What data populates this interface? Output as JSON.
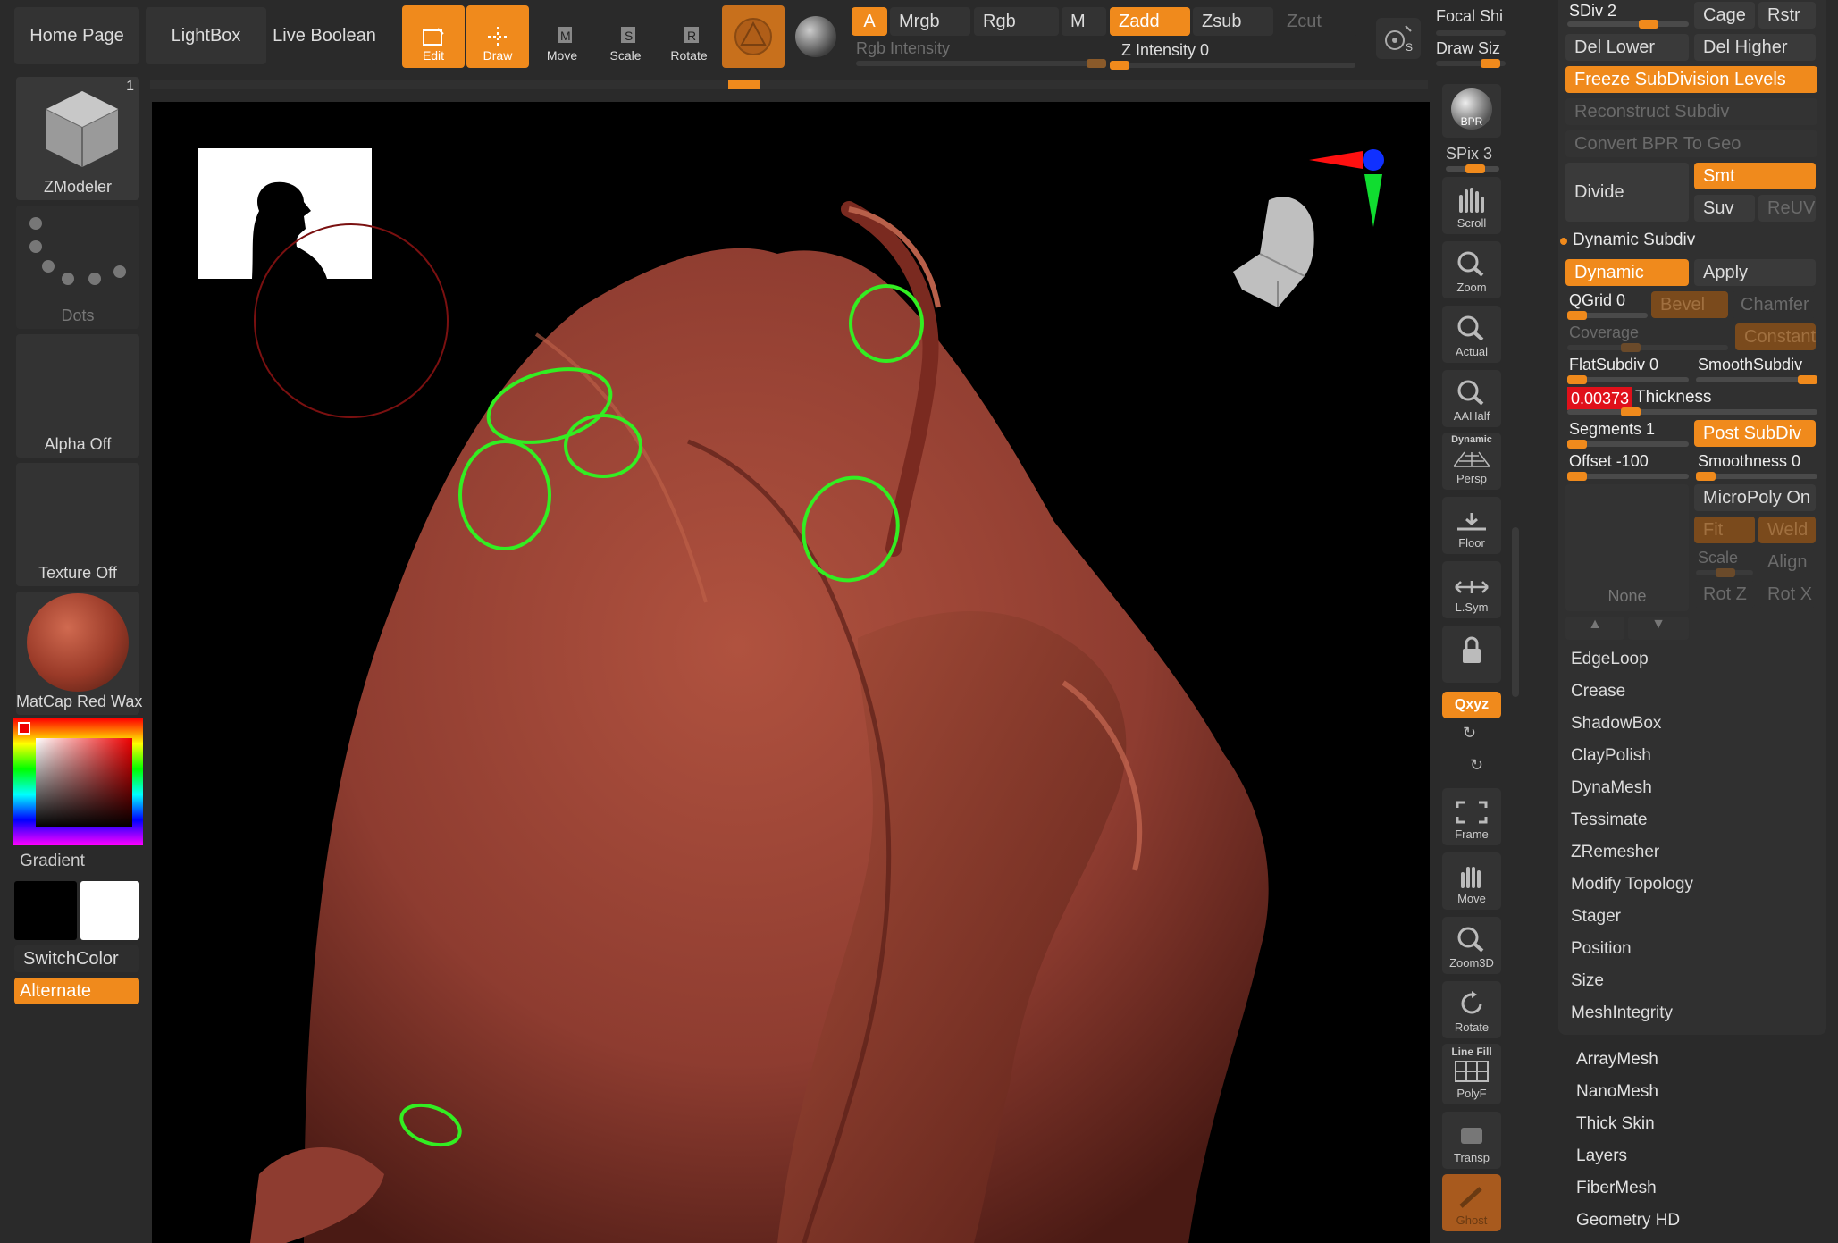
{
  "top_nav": {
    "home": "Home Page",
    "lightbox": "LightBox",
    "live_boolean": "Live Boolean"
  },
  "tools": {
    "edit": "Edit",
    "draw": "Draw",
    "move": "Move",
    "scale": "Scale",
    "rotate": "Rotate"
  },
  "color_modes": {
    "a": "A",
    "mrgb": "Mrgb",
    "rgb": "Rgb",
    "m": "M",
    "zadd": "Zadd",
    "zsub": "Zsub",
    "zcut": "Zcut"
  },
  "sliders": {
    "rgb_intensity": "Rgb Intensity",
    "z_intensity": "Z Intensity 0",
    "focal_shift": "Focal Shi",
    "draw_size": "Draw Siz"
  },
  "left_panel": {
    "zmodeler": "ZModeler",
    "zmodeler_count": "1",
    "dots": "Dots",
    "alpha": "Alpha Off",
    "texture": "Texture Off",
    "matcap": "MatCap Red Wax",
    "gradient": "Gradient",
    "switch_color": "SwitchColor",
    "alternate": "Alternate"
  },
  "right_toolbar": {
    "bpr": "BPR",
    "spix": "SPix 3",
    "scroll": "Scroll",
    "zoom": "Zoom",
    "actual": "Actual",
    "aahalf": "AAHalf",
    "dynamic": "Dynamic",
    "persp": "Persp",
    "floor": "Floor",
    "lsym": "L.Sym",
    "xyz": "Qxyz",
    "frame": "Frame",
    "move": "Move",
    "zoom3d": "Zoom3D",
    "rotate": "Rotate",
    "linefill": "Line Fill",
    "polyf": "PolyF",
    "transp": "Transp",
    "ghost": "Ghost"
  },
  "geometry_panel": {
    "sdiv": "SDiv 2",
    "cage": "Cage",
    "rstr": "Rstr",
    "del_lower": "Del Lower",
    "del_higher": "Del Higher",
    "freeze": "Freeze SubDivision Levels",
    "reconstruct": "Reconstruct Subdiv",
    "convert_bpr": "Convert BPR To Geo",
    "divide": "Divide",
    "smt": "Smt",
    "suv": "Suv",
    "reuv": "ReUV",
    "dynamic_subdiv": "Dynamic Subdiv",
    "dynamic": "Dynamic",
    "apply": "Apply",
    "qgrid": "QGrid 0",
    "bevel": "Bevel",
    "chamfer": "Chamfer",
    "coverage": "Coverage",
    "constant": "Constant",
    "flatsubdiv": "FlatSubdiv 0",
    "smoothsubdiv": "SmoothSubdiv",
    "thickness_value": "0.00373",
    "thickness": "Thickness",
    "segments": "Segments 1",
    "post_subdiv": "Post SubDiv",
    "offset": "Offset -100",
    "smoothness": "Smoothness 0",
    "micropoly": "MicroPoly On",
    "none": "None",
    "fit": "Fit",
    "weld": "Weld",
    "scale": "Scale",
    "align": "Align",
    "rotz": "Rot Z",
    "rotx": "Rot X"
  },
  "geometry_menu": [
    "EdgeLoop",
    "Crease",
    "ShadowBox",
    "ClayPolish",
    "DynaMesh",
    "Tessimate",
    "ZRemesher",
    "Modify Topology",
    "Stager",
    "Position",
    "Size",
    "MeshIntegrity"
  ],
  "subtool_menu": [
    "ArrayMesh",
    "NanoMesh",
    "Thick Skin",
    "Layers",
    "FiberMesh",
    "Geometry HD"
  ],
  "colors": {
    "accent": "#f08a1c",
    "highlight": "#33ee22",
    "model": "#8e3c30"
  }
}
